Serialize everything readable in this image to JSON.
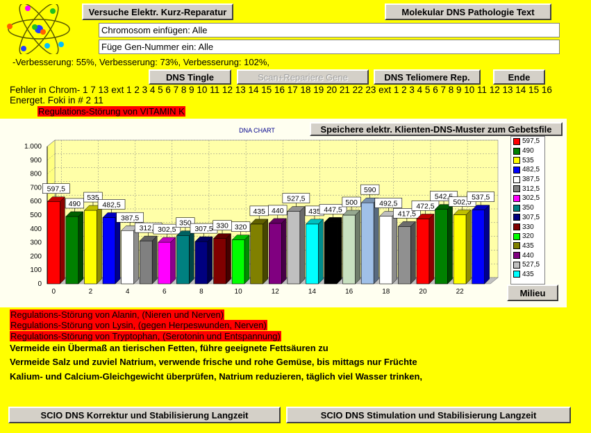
{
  "header": {
    "repair_button": "Versuche Elektr. Kurz-Reparatur",
    "pathology_button": "Molekular DNS Pathologie Text",
    "chromosome_field": "Chromosom einfügen: Alle",
    "gene_field": "Füge Gen-Nummer ein: Alle",
    "improvement_text": "-Verbesserung: 55%, Verbesserung: 73%, Verbesserung: 102%,"
  },
  "actions": {
    "tingle": "DNS Tingle",
    "scan_repair": "Scan+Repariere Gene",
    "telomere": "DNS Teliomere Rep.",
    "end": "Ende"
  },
  "info": {
    "error_line": "Fehler in Chrom- 1 7 13 ext 1 2 3 4 5 6 7 8 9 10 11 12 13 14 15 16 17 18 19 20 21 22 23 ext 1 2 3 4 5 6 7 8 9 10 11 12 13 14 15 16",
    "energy_line": "Energet. Foki in #  2 11",
    "vitamin_label": "Regulations-Störung von VITAMIN K"
  },
  "chart_panel": {
    "save_button": "Speichere elektr. Klienten-DNS-Muster zum Gebetsfile",
    "milieu_button": "Milieu"
  },
  "chart_data": {
    "type": "bar",
    "title": "DNA CHART",
    "xlabel": "",
    "ylabel": "",
    "ylim": [
      0,
      1000
    ],
    "yticks": [
      "0",
      "100",
      "200",
      "300",
      "400",
      "500",
      "600",
      "700",
      "800",
      "900",
      "1.000"
    ],
    "xticks": [
      0,
      2,
      4,
      6,
      8,
      10,
      12,
      14,
      16,
      18,
      20,
      22
    ],
    "grid": true,
    "three_d": true,
    "legend_position": "right",
    "values": [
      597.5,
      490,
      535,
      482.5,
      387.5,
      312.5,
      302.5,
      350,
      307.5,
      330,
      320,
      435,
      440,
      527.5,
      435,
      447.5,
      500,
      590,
      492.5,
      417.5,
      472.5,
      542.5,
      502.5,
      537.5
    ],
    "labels": [
      "597,5",
      "490",
      "535",
      "482,5",
      "387,5",
      "312,5",
      "302,5",
      "350",
      "307,5",
      "330",
      "320",
      "435",
      "440",
      "527,5",
      "435",
      "447,5",
      "500",
      "590",
      "492,5",
      "417,5",
      "472,5",
      "542,5",
      "502,5",
      "537,5"
    ],
    "colors": [
      "#ff0000",
      "#008000",
      "#ffff00",
      "#0000ff",
      "#ffffff",
      "#808080",
      "#ff00ff",
      "#008080",
      "#000080",
      "#800000",
      "#00ff00",
      "#808000",
      "#800080",
      "#c0c0c0",
      "#00ffff",
      "#000000",
      "#c8e0c0",
      "#a0c0e8",
      "#ffffff",
      "#909090",
      "#ff0000",
      "#008000",
      "#ffff00",
      "#0000ff"
    ],
    "legend_labels": [
      "597,5",
      "490",
      "535",
      "482,5",
      "387,5",
      "312,5",
      "302,5",
      "350",
      "307,5",
      "330",
      "320",
      "435",
      "440",
      "527,5",
      "435"
    ]
  },
  "messages": {
    "alanin": "Regulations-Störung von Alanin, (Nieren und Nerven)",
    "lysin": "Regulations-Störung von Lysin, (gegen Herpeswunden, Nerven)",
    "tryptophan": "Regulations-Störung von Tryptophan, (Serotonin und Entspannung)",
    "advice1": "Vermeide ein Übermaß an tierischen Fetten, führe geeignete Fettsäuren zu",
    "advice2": "Vermeide Salz und zuviel Natrium, verwende frische und rohe Gemüse, bis mittags nur Früchte",
    "advice3": "Kalium- und Calcium-Gleichgewicht überprüfen, Natrium reduzieren, täglich viel Wasser trinken,"
  },
  "footer": {
    "correction_button": "SCIO DNS Korrektur und Stabilisierung Langzeit",
    "stimulation_button": "SCIO DNS Stimulation und Stabilisierung Langzeit"
  },
  "icons": {
    "logo": "atom-icon"
  }
}
